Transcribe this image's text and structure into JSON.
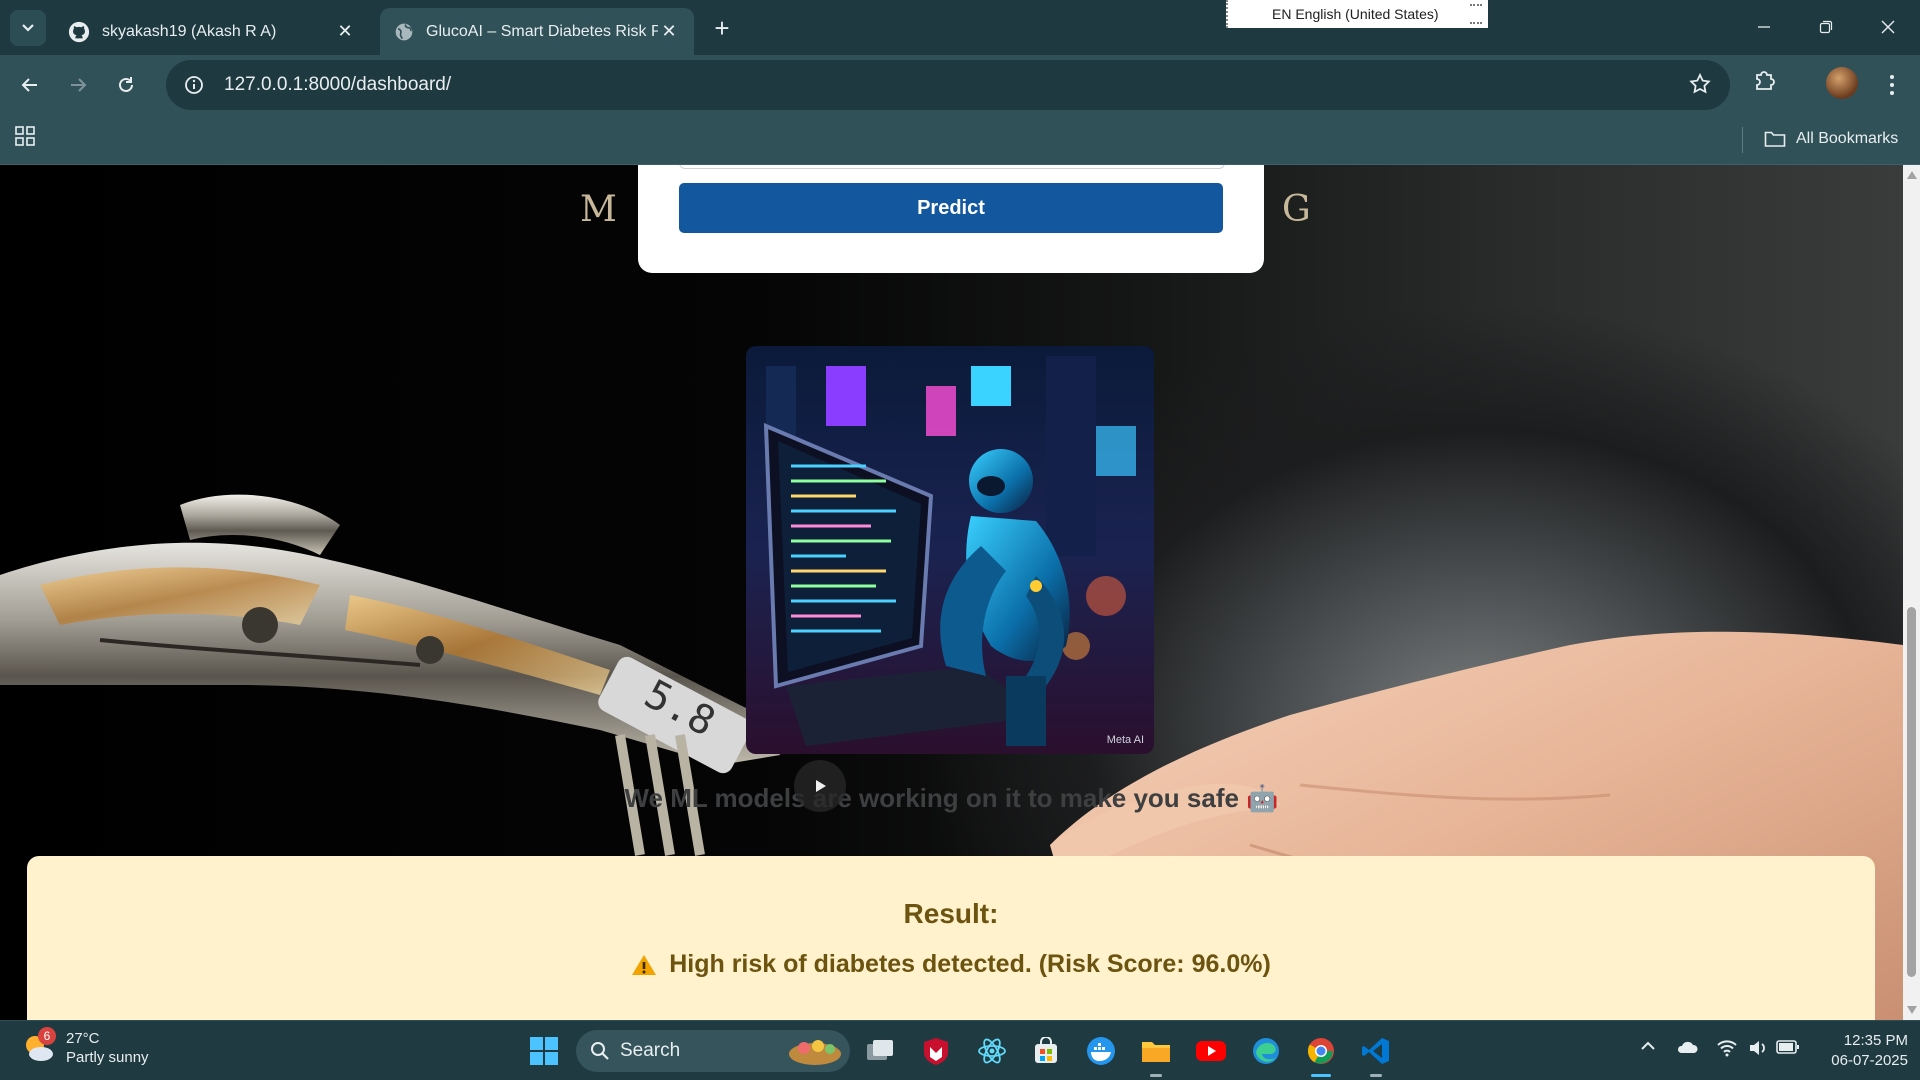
{
  "browser": {
    "tabs": [
      {
        "title": "skyakash19 (Akash R A)",
        "active": false
      },
      {
        "title": "GlucoAI – Smart Diabetes Risk P",
        "active": true
      }
    ],
    "language_indicator": "EN English (United States)",
    "url": "127.0.0.1:8000/dashboard/",
    "bookmarks_label": "All Bookmarks"
  },
  "page": {
    "bg_letter_left": "M",
    "bg_letter_right": "G",
    "predict_label": "Predict",
    "image_watermark": "Meta AI",
    "status_text": "We ML models are working on it to make you safe 🤖",
    "result": {
      "title": "Result:",
      "message": "High risk of diabetes detected. (Risk Score: 96.0%)",
      "warning_icon": "warning-icon",
      "bg_color": "#fff2cc",
      "text_color": "#6c5410"
    },
    "accent_color": "#13579f"
  },
  "taskbar": {
    "weather": {
      "temp": "27°C",
      "condition": "Partly sunny",
      "badge": "6"
    },
    "search_label": "Search",
    "time": "12:35 PM",
    "date": "06-07-2025"
  }
}
